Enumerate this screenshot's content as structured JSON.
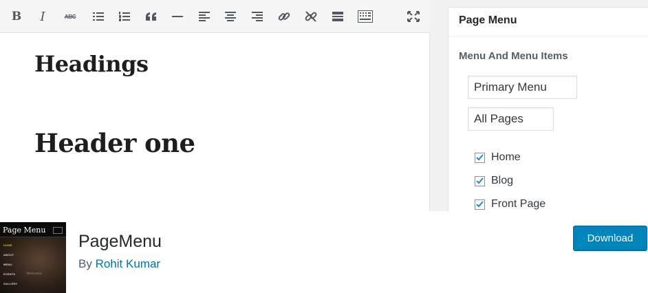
{
  "editor": {
    "toolbar": {
      "bold_glyph": "B",
      "italic_glyph": "I",
      "strike_glyph": "ABC",
      "icons": [
        "bold-icon",
        "italic-icon",
        "strikethrough-icon",
        "bullet-list-icon",
        "numbered-list-icon",
        "blockquote-icon",
        "horizontal-line-icon",
        "align-left-icon",
        "align-center-icon",
        "align-right-icon",
        "insert-link-icon",
        "remove-link-icon",
        "read-more-icon",
        "toolbar-toggle-icon",
        "fullscreen-icon"
      ]
    },
    "heading_1": "Headings",
    "heading_2": "Header one"
  },
  "sidebar": {
    "title": "Page Menu",
    "section_label": "Menu And Menu Items",
    "menu_select": "Primary Menu",
    "pages_select": "All Pages",
    "items": [
      {
        "label": "Home",
        "checked": true
      },
      {
        "label": "Blog",
        "checked": true
      },
      {
        "label": "Front Page",
        "checked": true
      }
    ]
  },
  "plugin": {
    "name": "PageMenu",
    "by_prefix": "By",
    "author": "Rohit Kumar",
    "download_label": "Download",
    "accent_color": "#0085ba",
    "thumbnail": {
      "title": "Page Menu",
      "items": [
        "HOME",
        "ABOUT",
        "MENU",
        "EVENTS",
        "GALLERY"
      ],
      "welcome": "Welcome"
    }
  }
}
